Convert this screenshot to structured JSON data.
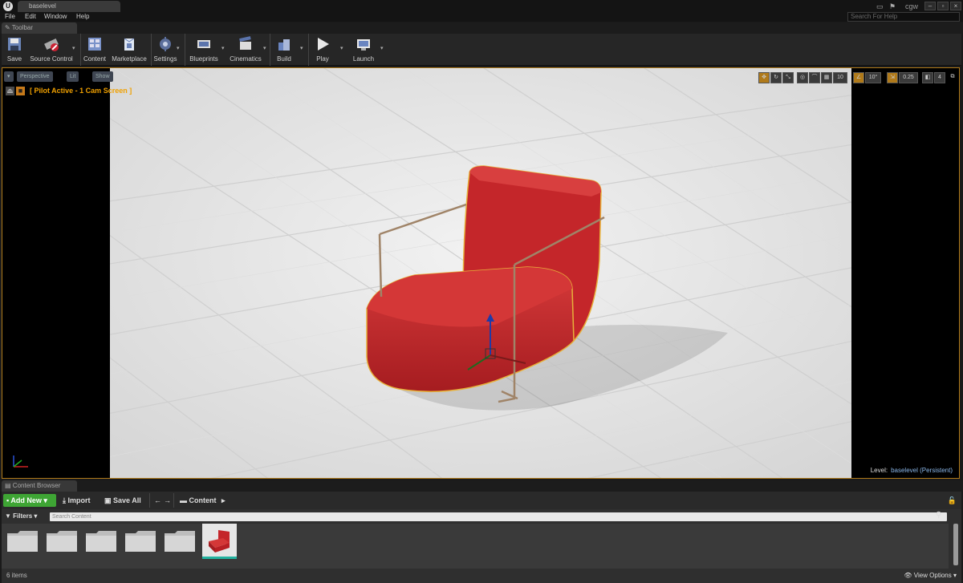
{
  "window": {
    "tab": "baselevel",
    "user": "cgw",
    "search_help_placeholder": "Search For Help"
  },
  "menu": [
    "File",
    "Edit",
    "Window",
    "Help"
  ],
  "toolbar_tab": "Toolbar",
  "toolbar": {
    "save": "Save",
    "source_control": "Source Control",
    "content": "Content",
    "marketplace": "Marketplace",
    "settings": "Settings",
    "blueprints": "Blueprints",
    "cinematics": "Cinematics",
    "build": "Build",
    "play": "Play",
    "launch": "Launch"
  },
  "viewport": {
    "view_mode": "Perspective",
    "lighting": "Lit",
    "show": "Show",
    "pilot_text": "[ Pilot Active - 1 Cam Screen ]",
    "snap_grid": "10",
    "snap_rotation": "10°",
    "snap_scale": "0.25",
    "camera_speed": "4",
    "level_label": "Level:",
    "level_name": "baselevel (Persistent)"
  },
  "content_browser": {
    "tab": "Content Browser",
    "add_new": "Add New",
    "import": "Import",
    "save_all": "Save All",
    "path": "Content",
    "filters": "Filters",
    "search_placeholder": "Search Content",
    "item_count": "6 items",
    "view_options": "View Options"
  },
  "colors": {
    "accent_green": "#3ea534",
    "selection_orange": "#f0a000",
    "chair_red": "#c4262a"
  }
}
